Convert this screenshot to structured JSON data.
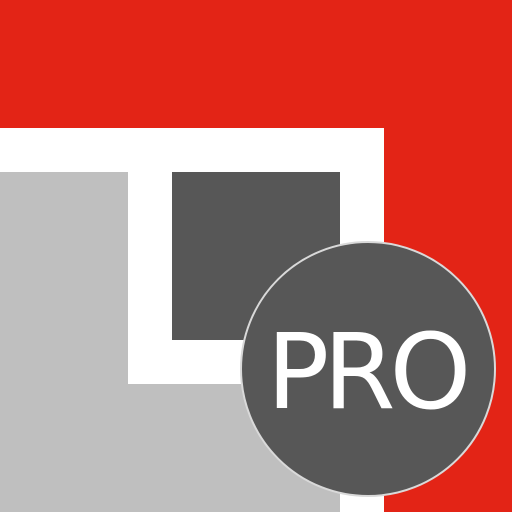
{
  "badge": {
    "label": "PRO"
  },
  "colors": {
    "background_red": "#e32416",
    "frame_white": "#ffffff",
    "panel_light_gray": "#bfbfbf",
    "square_dark_gray": "#575757",
    "badge_dark_gray": "#575757",
    "badge_text": "#ffffff"
  }
}
